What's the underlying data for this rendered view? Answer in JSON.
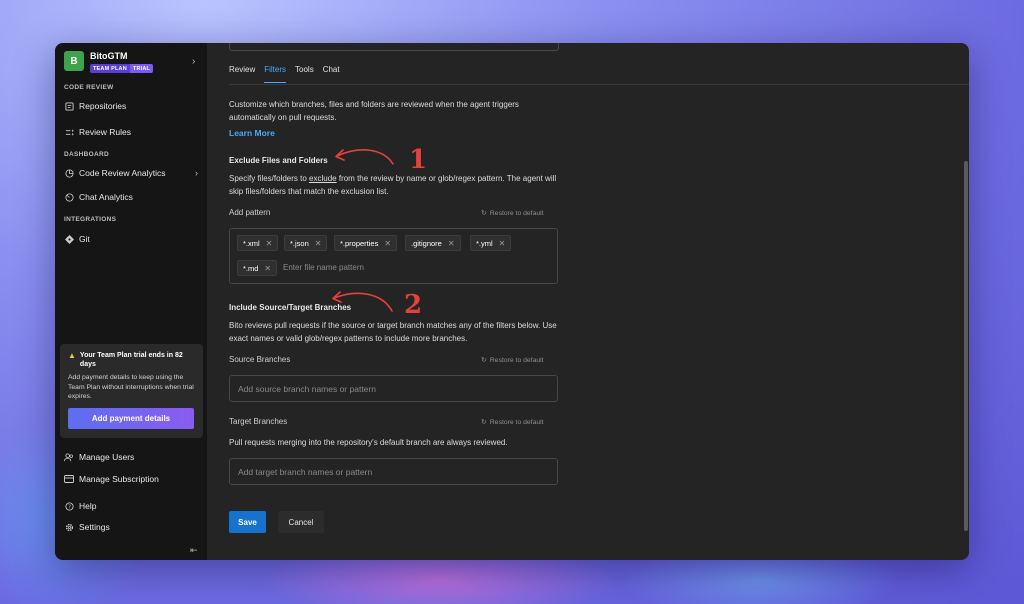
{
  "org": {
    "avatar_letter": "B",
    "name": "BitoGTM",
    "plan_badge": "TEAM PLAN",
    "trial_badge": "TRIAL"
  },
  "sidebar": {
    "sections": {
      "code_review": "CODE REVIEW",
      "dashboard": "DASHBOARD",
      "integrations": "INTEGRATIONS"
    },
    "items": [
      {
        "label": "Repositories",
        "icon": "repo-icon"
      },
      {
        "label": "Review Rules",
        "icon": "rules-icon"
      },
      {
        "label": "Code Review Analytics",
        "icon": "analytics-icon"
      },
      {
        "label": "Chat Analytics",
        "icon": "chat-analytics-icon"
      },
      {
        "label": "Git",
        "icon": "git-icon"
      },
      {
        "label": "Manage Users",
        "icon": "users-icon"
      },
      {
        "label": "Manage Subscription",
        "icon": "subscription-icon"
      },
      {
        "label": "Help",
        "icon": "help-icon"
      },
      {
        "label": "Settings",
        "icon": "gear-icon"
      }
    ]
  },
  "trial": {
    "title": "Your Team Plan trial ends in 82 days",
    "body": "Add payment details to keep using the Team Plan without interruptions when trial expires.",
    "button": "Add payment details"
  },
  "tabs": [
    {
      "label": "Review",
      "active": false
    },
    {
      "label": "Filters",
      "active": true
    },
    {
      "label": "Tools",
      "active": false
    },
    {
      "label": "Chat",
      "active": false
    }
  ],
  "filters": {
    "intro": "Customize which branches, files and folders are reviewed when the agent triggers automatically on pull requests.",
    "learn_more": "Learn More",
    "exclude_title": "Exclude Files and Folders",
    "exclude_desc_pre": "Specify files/folders to ",
    "exclude_desc_link": "exclude",
    "exclude_desc_post": " from the review by name or glob/regex pattern. The agent will skip files/folders that match the exclusion list.",
    "add_pattern_label": "Add pattern",
    "restore_label": "Restore to default",
    "patterns": [
      "*.xml",
      "*.json",
      "*.properties",
      ".gitignore",
      "*.yml",
      "*.md"
    ],
    "pattern_placeholder": "Enter file name pattern",
    "include_title": "Include Source/Target Branches",
    "include_desc": "Bito reviews pull requests if the source or target branch matches any of the filters below. Use exact names or valid glob/regex patterns to include more branches.",
    "source_label": "Source Branches",
    "source_placeholder": "Add source branch names or pattern",
    "target_label": "Target Branches",
    "target_desc": "Pull requests merging into the repository's default branch are always reviewed.",
    "target_placeholder": "Add target branch names or pattern",
    "save": "Save",
    "cancel": "Cancel"
  },
  "annotations": {
    "first": "1",
    "second": "2",
    "color": "#e8403a"
  },
  "colors": {
    "accent": "#4aa8ff",
    "save": "#1672cc",
    "avatar": "#3fa34d",
    "badge": "#5a3fd6"
  }
}
